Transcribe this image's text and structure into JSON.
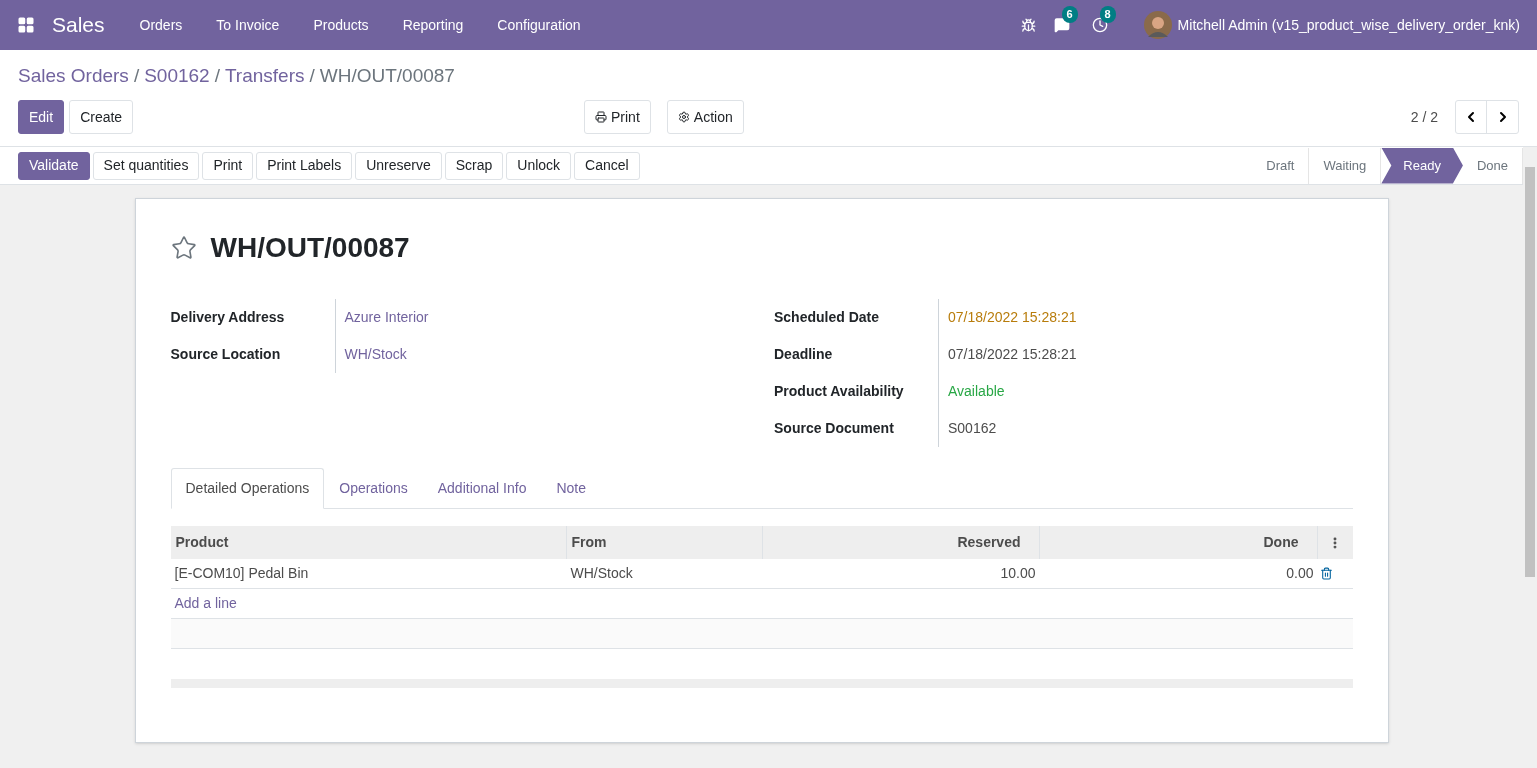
{
  "navbar": {
    "app": "Sales",
    "menu": [
      "Orders",
      "To Invoice",
      "Products",
      "Reporting",
      "Configuration"
    ],
    "messages_badge": "6",
    "activities_badge": "8",
    "user": "Mitchell Admin (v15_product_wise_delivery_order_knk)"
  },
  "breadcrumb_separator": "/",
  "breadcrumbs": [
    {
      "label": "Sales Orders",
      "kind": "link"
    },
    {
      "label": "S00162",
      "kind": "link"
    },
    {
      "label": "Transfers",
      "kind": "link"
    },
    {
      "label": "WH/OUT/00087",
      "kind": "current"
    }
  ],
  "main_buttons": [
    {
      "label": "Edit",
      "primary": true
    },
    {
      "label": "Create",
      "primary": false
    }
  ],
  "print_button": "Print",
  "action_button": "Action",
  "pager": "2 / 2",
  "header_buttons": [
    {
      "label": "Validate",
      "primary": true
    },
    {
      "label": "Set quantities",
      "primary": false
    },
    {
      "label": "Print",
      "primary": false
    },
    {
      "label": "Print Labels",
      "primary": false
    },
    {
      "label": "Unreserve",
      "primary": false
    },
    {
      "label": "Scrap",
      "primary": false
    },
    {
      "label": "Unlock",
      "primary": false
    },
    {
      "label": "Cancel",
      "primary": false
    }
  ],
  "stages": [
    {
      "label": "Draft",
      "selected": false
    },
    {
      "label": "Waiting",
      "selected": false
    },
    {
      "label": "Ready",
      "selected": true
    },
    {
      "label": "Done",
      "selected": false
    }
  ],
  "record": {
    "title": "WH/OUT/00087",
    "starred": false,
    "left_fields": [
      {
        "label": "Delivery Address",
        "value": "Azure Interior",
        "kind": "link"
      },
      {
        "label": "Source Location",
        "value": "WH/Stock",
        "kind": "link"
      }
    ],
    "right_fields": [
      {
        "label": "Scheduled Date",
        "value": "07/18/2022 15:28:21",
        "kind": "warning"
      },
      {
        "label": "Deadline",
        "value": "07/18/2022 15:28:21",
        "kind": "text"
      },
      {
        "label": "Product Availability",
        "value": "Available",
        "kind": "success"
      },
      {
        "label": "Source Document",
        "value": "S00162",
        "kind": "text"
      }
    ]
  },
  "tabs": [
    {
      "label": "Detailed Operations",
      "selected": true
    },
    {
      "label": "Operations",
      "selected": false
    },
    {
      "label": "Additional Info",
      "selected": false
    },
    {
      "label": "Note",
      "selected": false
    }
  ],
  "table": {
    "columns": [
      "Product",
      "From",
      "Reserved",
      "Done"
    ],
    "rows": [
      {
        "product": "[E-COM10] Pedal Bin",
        "from": "WH/Stock",
        "reserved": "10.00",
        "done": "0.00"
      }
    ],
    "add_line": "Add a line"
  }
}
